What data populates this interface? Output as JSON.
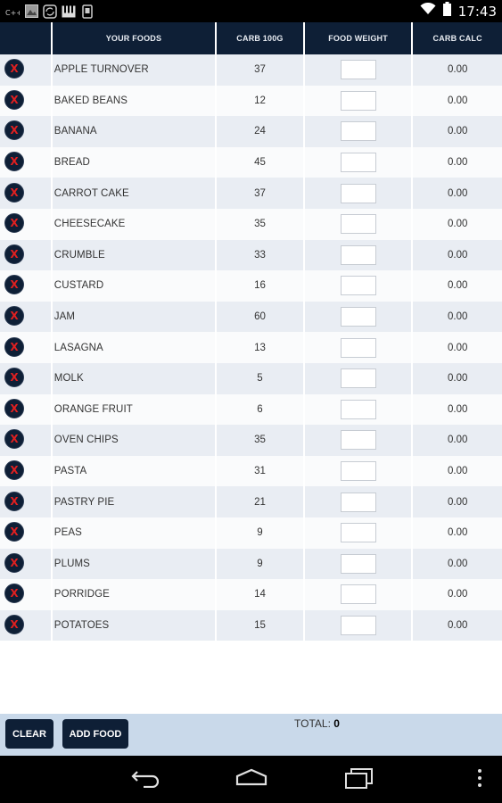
{
  "status_bar": {
    "time": "17:43",
    "left_icons": [
      "cpp-icon",
      "gallery-icon",
      "sync-icon",
      "piano-icon",
      "phone-icon"
    ],
    "right_icons": [
      "wifi-icon",
      "battery-icon"
    ]
  },
  "table": {
    "headers": [
      "",
      "YOUR FOODS",
      "CARB 100G",
      "FOOD WEIGHT",
      "CARB CALC"
    ],
    "delete_glyph": "X",
    "rows": [
      {
        "food": "APPLE TURNOVER",
        "carb": "37",
        "weight": "",
        "calc": "0.00"
      },
      {
        "food": "BAKED BEANS",
        "carb": "12",
        "weight": "",
        "calc": "0.00"
      },
      {
        "food": "BANANA",
        "carb": "24",
        "weight": "",
        "calc": "0.00"
      },
      {
        "food": "BREAD",
        "carb": "45",
        "weight": "",
        "calc": "0.00"
      },
      {
        "food": "CARROT CAKE",
        "carb": "37",
        "weight": "",
        "calc": "0.00"
      },
      {
        "food": "CHEESECAKE",
        "carb": "35",
        "weight": "",
        "calc": "0.00"
      },
      {
        "food": "CRUMBLE",
        "carb": "33",
        "weight": "",
        "calc": "0.00"
      },
      {
        "food": "CUSTARD",
        "carb": "16",
        "weight": "",
        "calc": "0.00"
      },
      {
        "food": "JAM",
        "carb": "60",
        "weight": "",
        "calc": "0.00"
      },
      {
        "food": "LASAGNA",
        "carb": "13",
        "weight": "",
        "calc": "0.00"
      },
      {
        "food": "MOLK",
        "carb": "5",
        "weight": "",
        "calc": "0.00"
      },
      {
        "food": "ORANGE FRUIT",
        "carb": "6",
        "weight": "",
        "calc": "0.00"
      },
      {
        "food": "OVEN CHIPS",
        "carb": "35",
        "weight": "",
        "calc": "0.00"
      },
      {
        "food": "PASTA",
        "carb": "31",
        "weight": "",
        "calc": "0.00"
      },
      {
        "food": "PASTRY PIE",
        "carb": "21",
        "weight": "",
        "calc": "0.00"
      },
      {
        "food": "PEAS",
        "carb": "9",
        "weight": "",
        "calc": "0.00"
      },
      {
        "food": "PLUMS",
        "carb": "9",
        "weight": "",
        "calc": "0.00"
      },
      {
        "food": "PORRIDGE",
        "carb": "14",
        "weight": "",
        "calc": "0.00"
      },
      {
        "food": "POTATOES",
        "carb": "15",
        "weight": "",
        "calc": "0.00"
      }
    ]
  },
  "footer": {
    "clear_label": "CLEAR",
    "add_food_label": "ADD FOOD",
    "total_label": "TOTAL:",
    "total_value": "0"
  },
  "nav_bar": {
    "buttons": [
      "back-icon",
      "home-icon",
      "recent-apps-icon",
      "menu-icon"
    ]
  },
  "colors": {
    "header_bg": "#0e1f36",
    "row_alt_bg": "#e9edf3",
    "footer_bg": "#c9d9ea",
    "delete_x": "#e02020"
  }
}
